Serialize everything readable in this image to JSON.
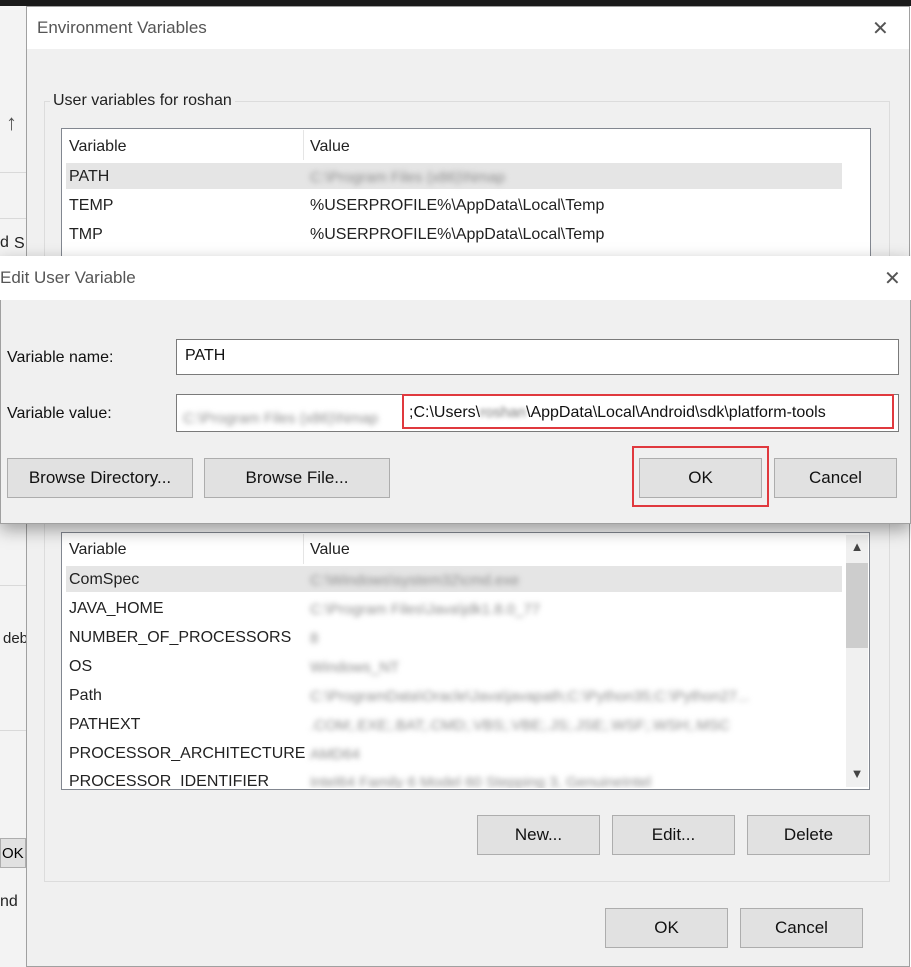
{
  "background_app": {
    "partial_d": "d",
    "partial_s": "S",
    "partial_deb": "deb",
    "partial_ok": "OK",
    "partial_nd": "nd"
  },
  "env_dialog": {
    "title": "Environment Variables",
    "close_glyph": "✕",
    "user_section_label": "User variables for roshan",
    "user_list": {
      "headers": [
        "Variable",
        "Value"
      ],
      "rows": [
        {
          "variable": "PATH",
          "value": "C:\\Program Files (x86)\\Nmap"
        },
        {
          "variable": "TEMP",
          "value": "%USERPROFILE%\\AppData\\Local\\Temp"
        },
        {
          "variable": "TMP",
          "value": "%USERPROFILE%\\AppData\\Local\\Temp"
        }
      ]
    },
    "system_list": {
      "headers": [
        "Variable",
        "Value"
      ],
      "rows": [
        {
          "variable": "ComSpec",
          "value": "C:\\Windows\\system32\\cmd.exe"
        },
        {
          "variable": "JAVA_HOME",
          "value": "C:\\Program Files\\Java\\jdk1.8.0_77"
        },
        {
          "variable": "NUMBER_OF_PROCESSORS",
          "value": "8"
        },
        {
          "variable": "OS",
          "value": "Windows_NT"
        },
        {
          "variable": "Path",
          "value": "C:\\ProgramData\\Oracle\\Java\\javapath;C:\\Python35;C:\\Python27..."
        },
        {
          "variable": "PATHEXT",
          "value": ".COM;.EXE;.BAT;.CMD;.VBS;.VBE;.JS;.JSE;.WSF;.WSH;.MSC"
        },
        {
          "variable": "PROCESSOR_ARCHITECTURE",
          "value": "AMD64"
        },
        {
          "variable": "PROCESSOR_IDENTIFIER",
          "value": "Intel64 Family 6 Model 60 Stepping 3, GenuineIntel"
        }
      ]
    },
    "new_button": "New...",
    "edit_button": "Edit...",
    "delete_button": "Delete",
    "ok_button": "OK",
    "cancel_button": "Cancel"
  },
  "edit_dialog": {
    "title": "Edit User Variable",
    "close_glyph": "✕",
    "name_label": "Variable name:",
    "name_value": "PATH",
    "value_label": "Variable value:",
    "value_blurred_prefix": "C:\\Program Files (x86)\\Nmap",
    "value_part1": ";C:\\Users\\",
    "value_user_blurred": "roshan",
    "value_part2": "\\AppData\\Local\\Android\\sdk\\platform-tools",
    "browse_directory_button": "Browse Directory...",
    "browse_file_button": "Browse File...",
    "ok_button": "OK",
    "cancel_button": "Cancel",
    "highlight_color": "#e0393e"
  },
  "icons": {
    "up_arrow": "🡑",
    "scroll_up": "▲",
    "scroll_down": "▼"
  }
}
